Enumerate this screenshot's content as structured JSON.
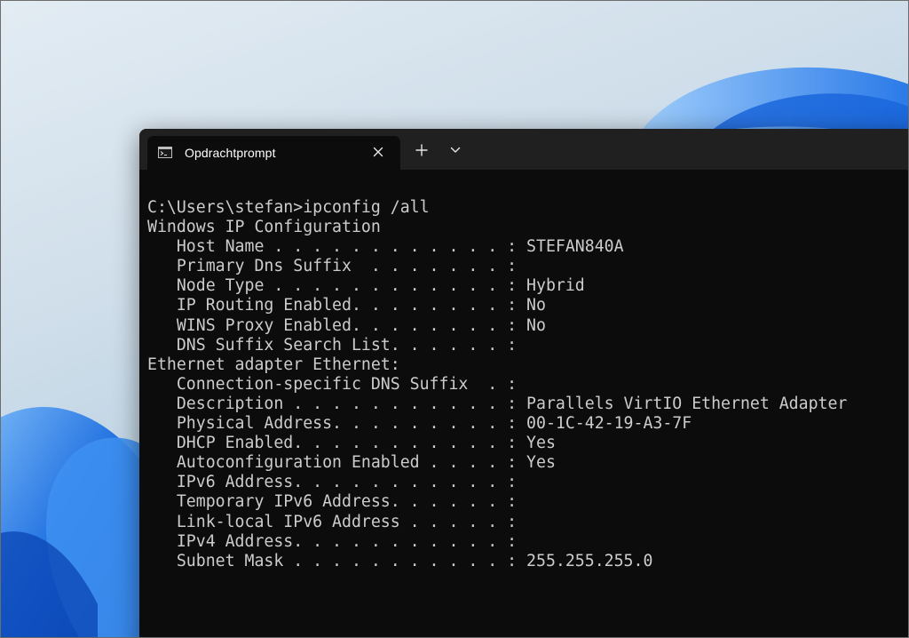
{
  "window": {
    "tab_title": "Opdrachtprompt",
    "tab_icon": "command-prompt-icon",
    "close_icon": "close-icon",
    "new_tab_icon": "plus-icon",
    "dropdown_icon": "chevron-down-icon"
  },
  "colors": {
    "background": "#0c0c0c",
    "titlebar": "#202020",
    "text": "#cccccc",
    "wallpaper_accent": "#1f6fe0"
  },
  "console": {
    "lines": [
      "C:\\Users\\stefan>ipconfig /all",
      "",
      "Windows IP Configuration",
      "",
      "   Host Name . . . . . . . . . . . . : STEFAN840A",
      "   Primary Dns Suffix  . . . . . . . :",
      "   Node Type . . . . . . . . . . . . : Hybrid",
      "   IP Routing Enabled. . . . . . . . : No",
      "   WINS Proxy Enabled. . . . . . . . : No",
      "   DNS Suffix Search List. . . . . . :",
      "",
      "Ethernet adapter Ethernet:",
      "",
      "   Connection-specific DNS Suffix  . :",
      "   Description . . . . . . . . . . . : Parallels VirtIO Ethernet Adapter",
      "   Physical Address. . . . . . . . . : 00-1C-42-19-A3-7F",
      "   DHCP Enabled. . . . . . . . . . . : Yes",
      "   Autoconfiguration Enabled . . . . : Yes",
      "   IPv6 Address. . . . . . . . . . . :",
      "   Temporary IPv6 Address. . . . . . :",
      "   Link-local IPv6 Address . . . . . :",
      "   IPv4 Address. . . . . . . . . . . :",
      "   Subnet Mask . . . . . . . . . . . : 255.255.255.0"
    ]
  }
}
